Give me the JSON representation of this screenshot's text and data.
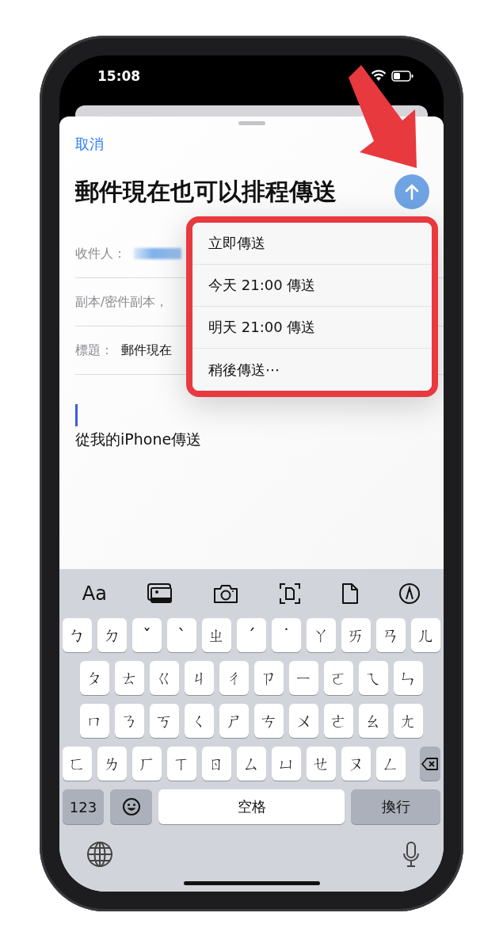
{
  "status_bar": {
    "time": "15:08"
  },
  "compose": {
    "cancel": "取消",
    "title": "郵件現在也可以排程傳送",
    "fields": [
      {
        "label": "收件人：",
        "kind": "redacted"
      },
      {
        "label": "副本/密件副本，",
        "kind": "empty"
      },
      {
        "label": "標題：",
        "value": "郵件現在",
        "kind": "text"
      }
    ],
    "signature": "從我的iPhone傳送"
  },
  "send_menu": {
    "items": [
      {
        "label": "立即傳送"
      },
      {
        "label": "今天 21:00 傳送"
      },
      {
        "label": "明天 21:00 傳送"
      },
      {
        "label": "稍後傳送⋯"
      }
    ]
  },
  "keyboard": {
    "format_label": "Aa",
    "rows": [
      [
        "ㄅ",
        "ㄉ",
        "ˇ",
        "ˋ",
        "ㄓ",
        "ˊ",
        "˙",
        "ㄚ",
        "ㄞ",
        "ㄢ",
        "ㄦ"
      ],
      [
        "ㄆ",
        "ㄊ",
        "ㄍ",
        "ㄐ",
        "ㄔ",
        "ㄗ",
        "ㄧ",
        "ㄛ",
        "ㄟ",
        "ㄣ"
      ],
      [
        "ㄇ",
        "ㄋ",
        "ㄎ",
        "ㄑ",
        "ㄕ",
        "ㄘ",
        "ㄨ",
        "ㄜ",
        "ㄠ",
        "ㄤ"
      ],
      [
        "ㄈ",
        "ㄌ",
        "ㄏ",
        "ㄒ",
        "ㄖ",
        "ㄙ",
        "ㄩ",
        "ㄝ",
        "ㄡ",
        "ㄥ"
      ]
    ],
    "bottom_keys": [
      {
        "kind": "text",
        "label": "123"
      },
      {
        "kind": "emoji"
      },
      {
        "kind": "space",
        "label": "空格"
      },
      {
        "kind": "text",
        "label": "換行"
      }
    ]
  }
}
